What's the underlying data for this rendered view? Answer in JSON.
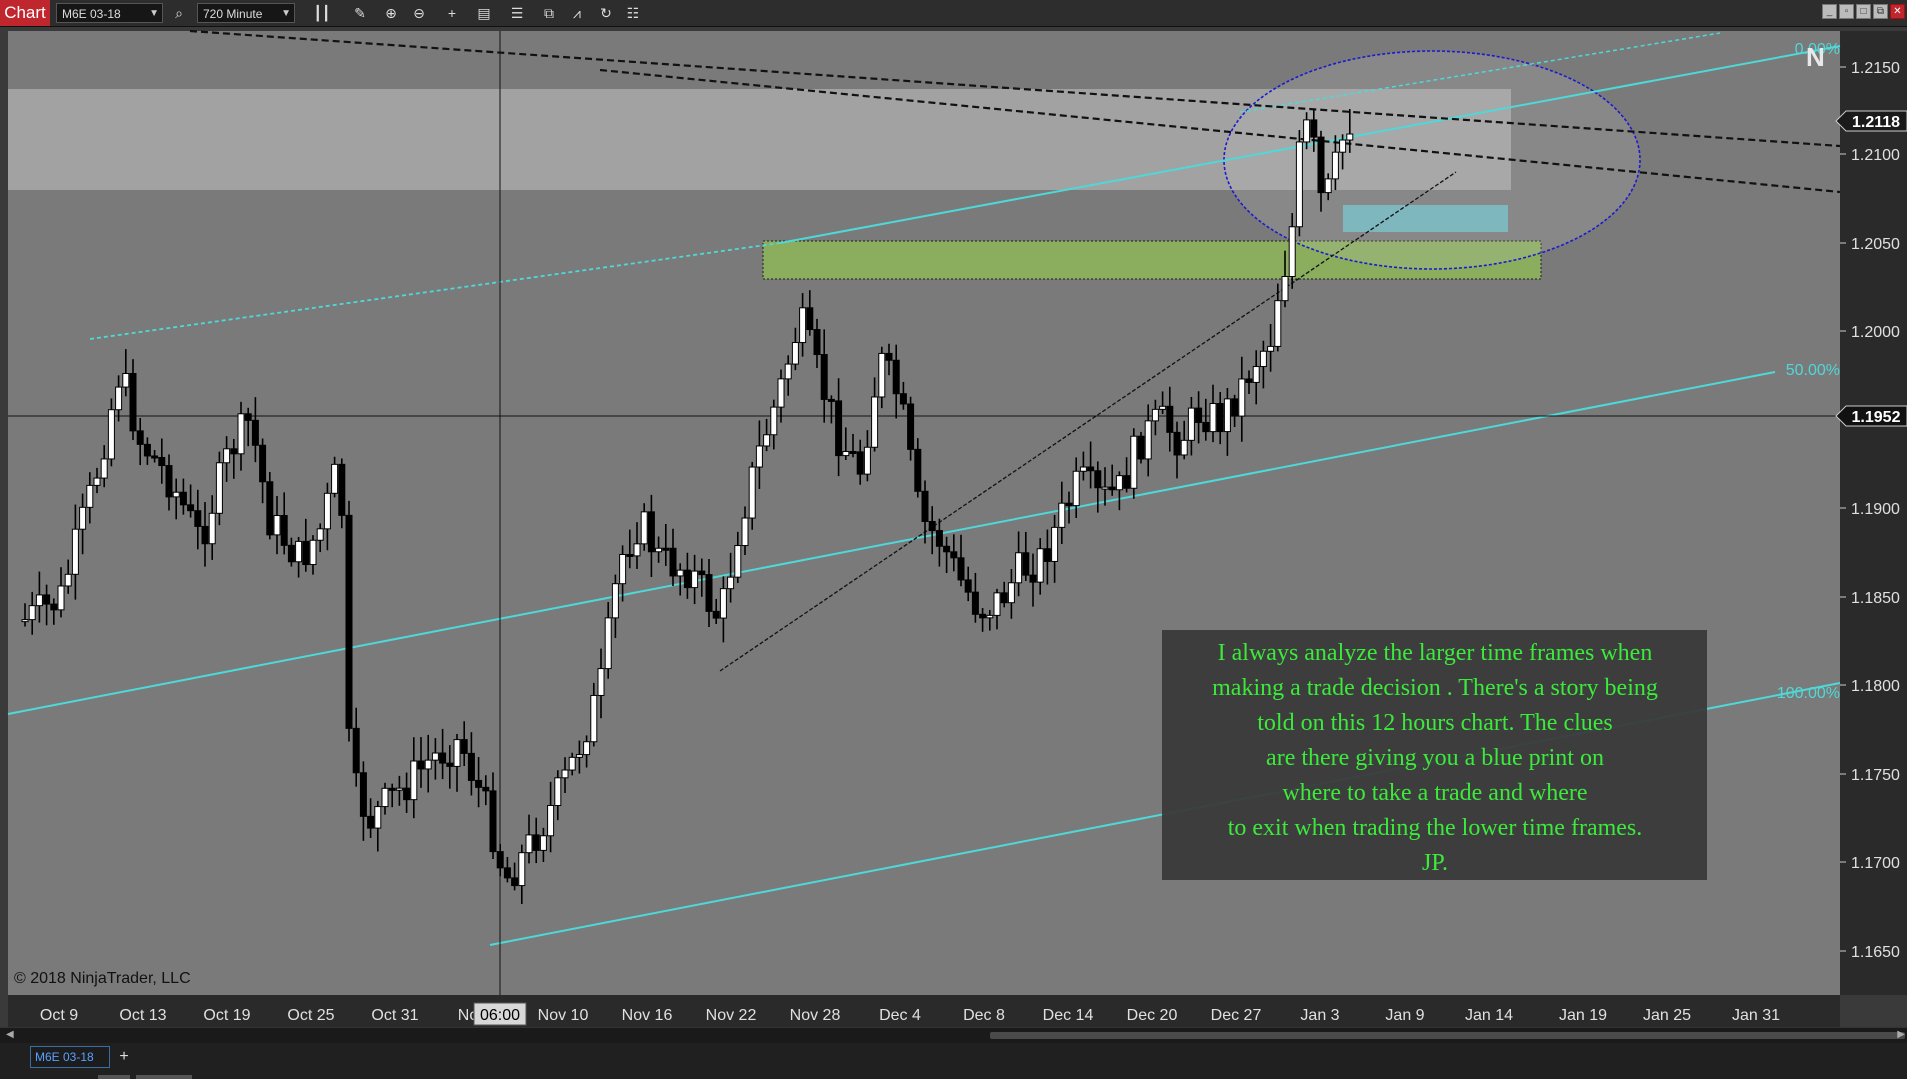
{
  "toolbar": {
    "chart_label": "Chart",
    "instrument": "M6E 03-18",
    "interval": "720 Minute"
  },
  "chart": {
    "copyright": "© 2018 NinjaTrader, LLC",
    "price_labels": [
      "1.2150",
      "1.2100",
      "1.2050",
      "1.2000",
      "1.1950",
      "1.1900",
      "1.1850",
      "1.1800",
      "1.1750",
      "1.1700",
      "1.1650"
    ],
    "last_price": "1.2118",
    "crosshair_price": "1.1952",
    "crosshair_time": "06:00",
    "date_labels": [
      "Oct 9",
      "Oct 13",
      "Oct 19",
      "Oct 25",
      "Oct 31",
      "No",
      "Nov 10",
      "Nov 16",
      "Nov 22",
      "Nov 28",
      "Dec 4",
      "Dec 8",
      "Dec 14",
      "Dec 20",
      "Dec 27",
      "Jan 3",
      "Jan 9",
      "Jan 14",
      "Jan 19",
      "Jan 25",
      "Jan 31"
    ],
    "fib_labels": [
      "0.00%",
      "50.00%",
      "100.00%"
    ],
    "annotation_lines": [
      "I always analyze the larger time frames when",
      "making a trade decision . There's a story being",
      "told on this 12 hours chart. The clues",
      "are there giving you a blue print on",
      "where to take a trade and where",
      "to exit when trading the lower time frames.",
      "JP."
    ],
    "colors": {
      "background": "#7a7a7a",
      "cyan": "#4fd8d8",
      "annotation_text": "#3bea3b",
      "annotation_bg": "#3a3a3a",
      "zone_green": "#8cb45a",
      "ellipse": "#1a1ad0"
    }
  },
  "tabs": [
    {
      "label": "M6E 03-18"
    }
  ]
}
